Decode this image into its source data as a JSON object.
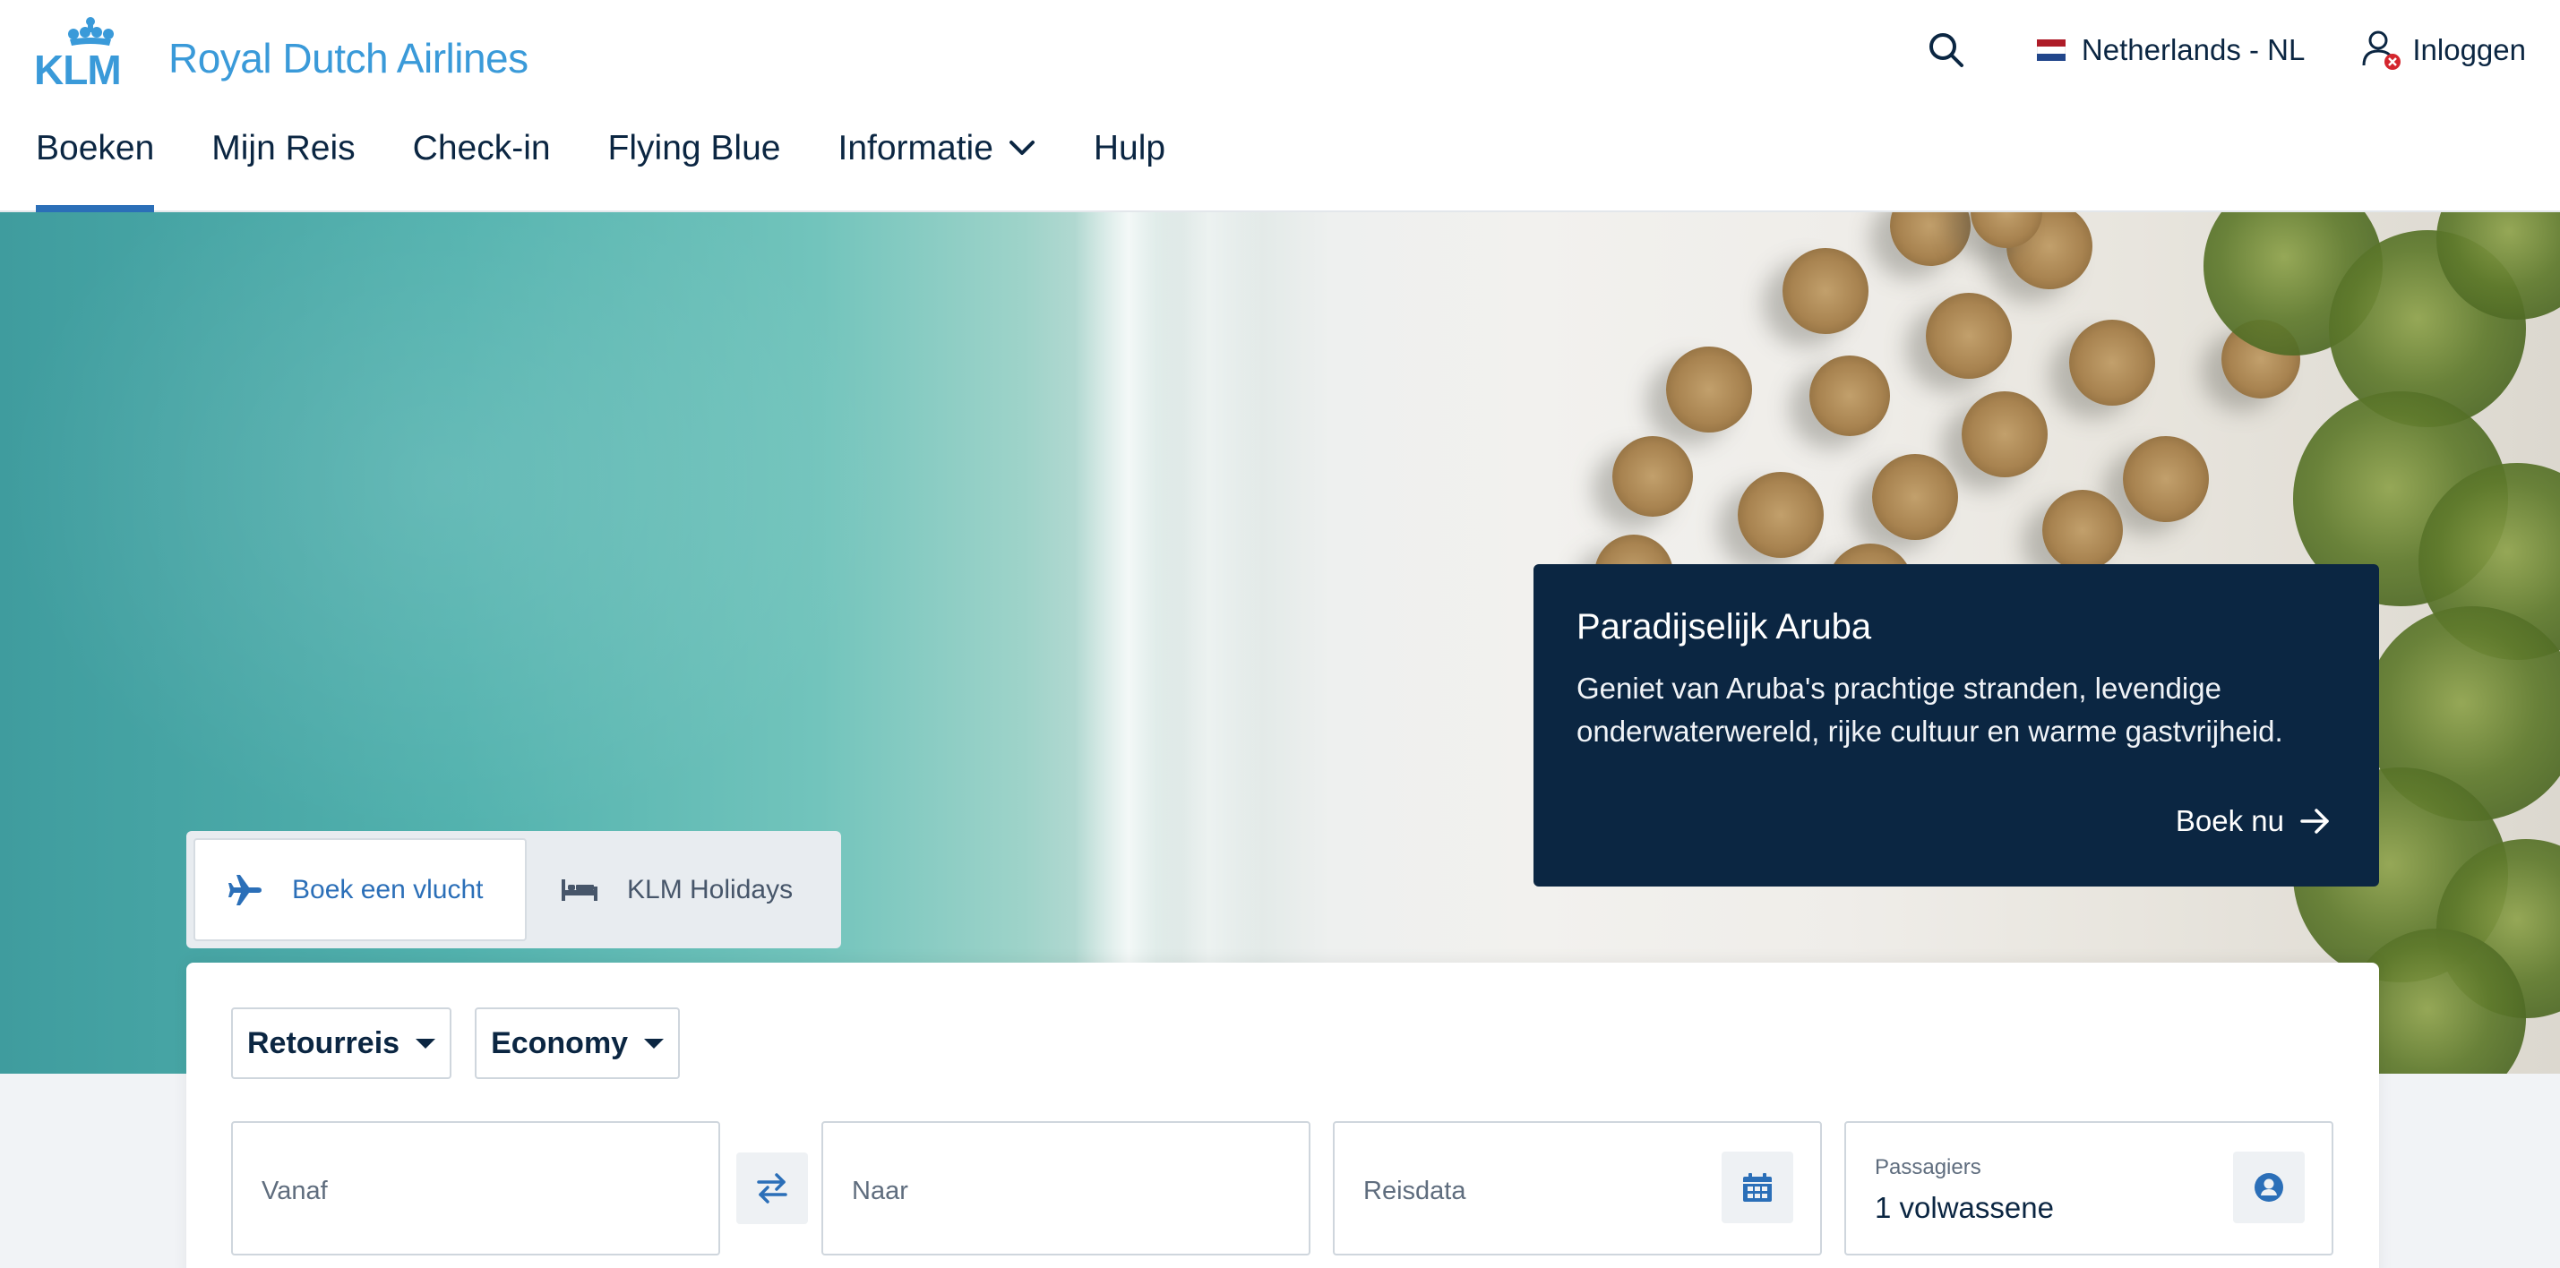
{
  "brand": {
    "logo_text": "KLM",
    "name": "Royal Dutch Airlines",
    "logo_color": "#3a9ad9",
    "primary_color": "#0b2642",
    "accent_color": "#2b6fb8"
  },
  "header": {
    "search_icon": "search-icon",
    "country_label": "Netherlands - NL",
    "flag_colors": [
      "#ae1c28",
      "#ffffff",
      "#21468b"
    ],
    "login_label": "Inloggen",
    "login_icon": "user-logged-out-icon"
  },
  "nav": {
    "items": [
      {
        "label": "Boeken",
        "active": true
      },
      {
        "label": "Mijn Reis"
      },
      {
        "label": "Check-in"
      },
      {
        "label": "Flying Blue"
      },
      {
        "label": "Informatie",
        "has_dropdown": true
      },
      {
        "label": "Hulp"
      }
    ]
  },
  "promo": {
    "title": "Paradijselijk Aruba",
    "text": "Geniet van Aruba's prachtige stranden, levendige onderwaterwereld, rijke cultuur en warme gastvrijheid.",
    "cta": "Boek nu",
    "cta_icon": "arrow-right-icon"
  },
  "tabs": [
    {
      "label": "Boek een vlucht",
      "icon": "plane-icon",
      "active": true
    },
    {
      "label": "KLM Holidays",
      "icon": "bed-icon"
    }
  ],
  "booking": {
    "trip_type": "Retourreis",
    "cabin_class": "Economy",
    "from_placeholder": "Vanaf",
    "to_placeholder": "Naar",
    "date_placeholder": "Reisdata",
    "passengers_label": "Passagiers",
    "passengers_value": "1 volwassene",
    "swap_icon": "swap-arrows-icon",
    "calendar_icon": "calendar-icon",
    "passenger_icon": "person-circle-icon"
  }
}
